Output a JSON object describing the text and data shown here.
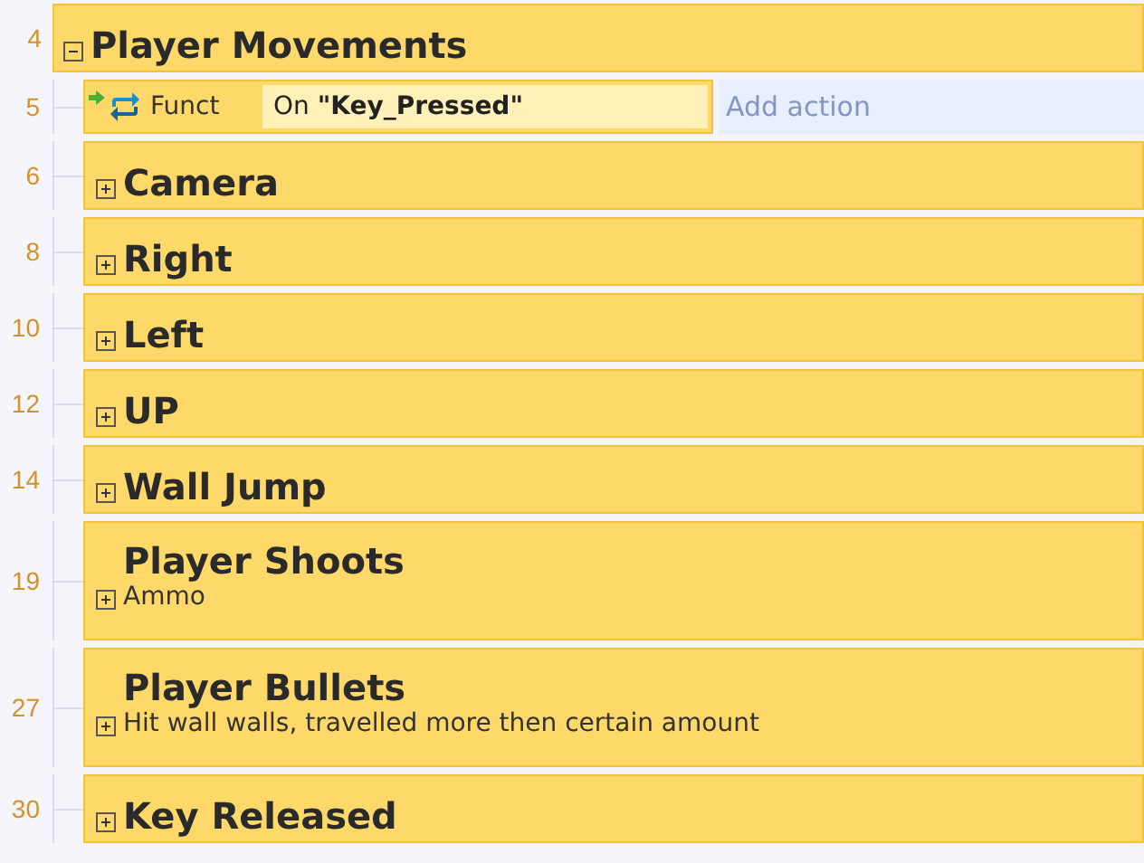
{
  "group": {
    "line": "4",
    "title": "Player Movements",
    "expanded": true,
    "children": [
      {
        "kind": "event",
        "line": "5",
        "label": "Funct",
        "condition": "On **\"Key_Pressed\"**",
        "action_placeholder": "Add action"
      },
      {
        "kind": "group",
        "line": "6",
        "title": "Camera",
        "expanded": false
      },
      {
        "kind": "group",
        "line": "8",
        "title": "Right",
        "expanded": false
      },
      {
        "kind": "group",
        "line": "10",
        "title": "Left",
        "expanded": false
      },
      {
        "kind": "group",
        "line": "12",
        "title": "UP",
        "expanded": false
      },
      {
        "kind": "group",
        "line": "14",
        "title": "Wall Jump",
        "expanded": false
      },
      {
        "kind": "group",
        "line": "19",
        "title": "Player Shoots",
        "expanded": false,
        "description": "Ammo"
      },
      {
        "kind": "group",
        "line": "27",
        "title": "Player Bullets",
        "expanded": false,
        "description": "Hit wall walls, travelled more then certain amount"
      },
      {
        "kind": "group",
        "line": "30",
        "title": "Key Released",
        "expanded": false
      }
    ]
  }
}
